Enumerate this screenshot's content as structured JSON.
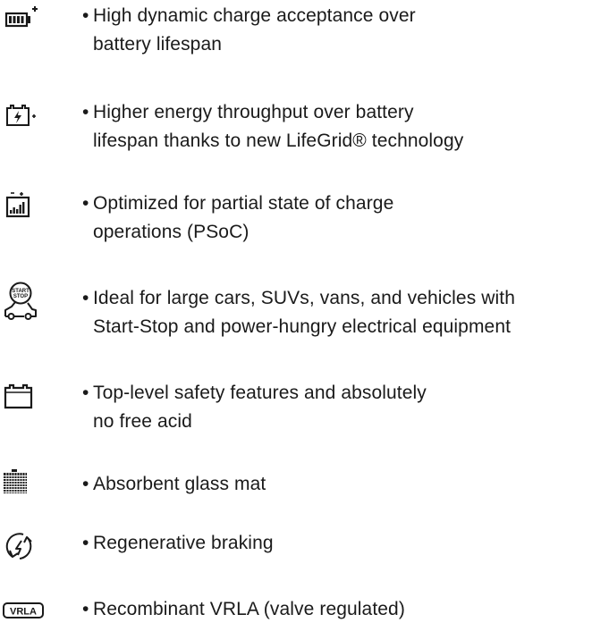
{
  "features": [
    {
      "icon": "battery-charge-icon",
      "bullet": "•",
      "lines": [
        "High dynamic charge acceptance over",
        "battery lifespan"
      ]
    },
    {
      "icon": "battery-energy-icon",
      "bullet": "•",
      "lines": [
        "Higher energy throughput over battery",
        "lifespan thanks to new LifeGrid® technology"
      ]
    },
    {
      "icon": "battery-bar-graph-icon",
      "bullet": "•",
      "lines": [
        "Optimized for partial state of charge",
        "operations (PSoC)"
      ]
    },
    {
      "icon": "start-stop-car-icon",
      "icon_text": [
        "START",
        "STOP"
      ],
      "bullet": "•",
      "lines": [
        "Ideal for large cars, SUVs, vans, and vehicles with",
        "Start-Stop and power-hungry electrical equipment"
      ]
    },
    {
      "icon": "battery-safety-icon",
      "bullet": "•",
      "lines": [
        "Top-level safety features and absolutely",
        "no free acid"
      ]
    },
    {
      "icon": "glass-mat-grid-icon",
      "bullet": "•",
      "lines": [
        "Absorbent glass mat"
      ]
    },
    {
      "icon": "regenerative-braking-icon",
      "bullet": "•",
      "lines": [
        "Regenerative braking"
      ]
    },
    {
      "icon": "vrla-badge-icon",
      "icon_text": "VRLA",
      "bullet": "•",
      "lines": [
        "Recombinant VRLA (valve regulated)"
      ]
    }
  ],
  "colors": {
    "text": "#1a1a1a",
    "icon": "#1a1a1a",
    "background": "#ffffff"
  }
}
